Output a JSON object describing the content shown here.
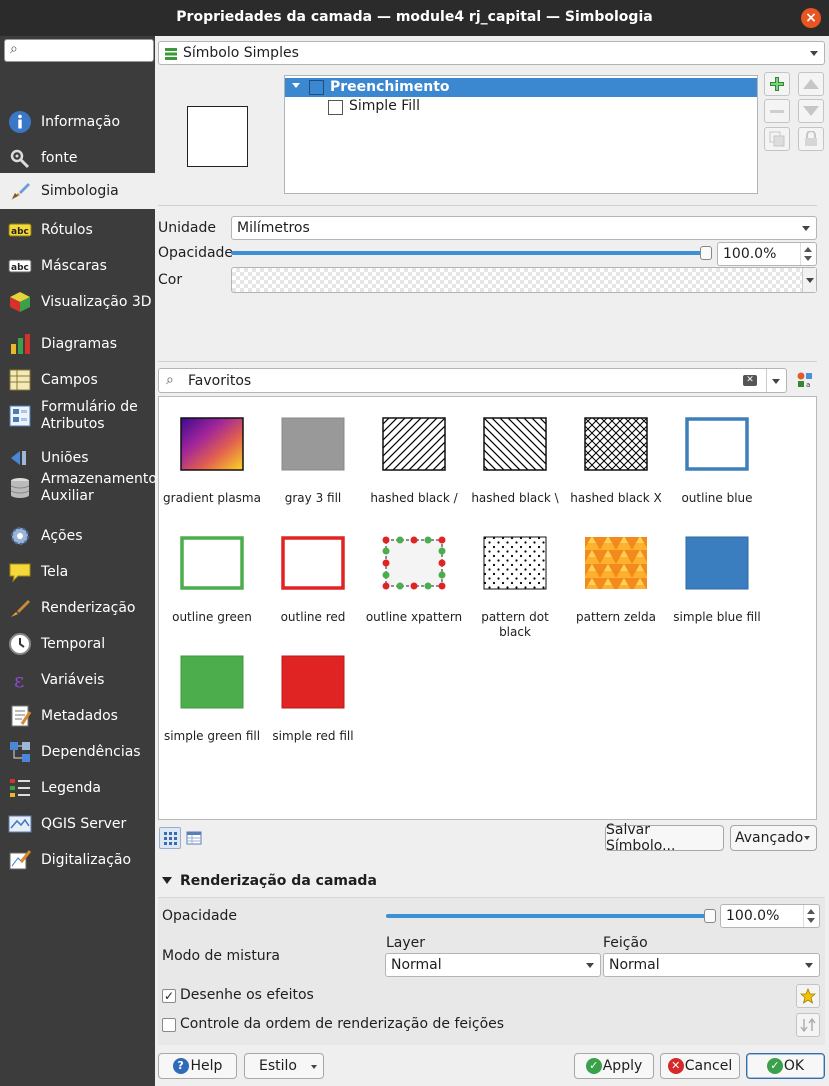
{
  "window": {
    "title": "Propriedades da camada — module4 rj_capital — Simbologia"
  },
  "sidebar": {
    "search_placeholder": "",
    "items": [
      {
        "label": "Informação",
        "icon": "info-icon"
      },
      {
        "label": "fonte",
        "icon": "source-settings-icon"
      },
      {
        "label": "Simbologia",
        "icon": "symbology-brush-icon",
        "active": true
      },
      {
        "label": "Rótulos",
        "icon": "labels-abc-icon"
      },
      {
        "label": "Máscaras",
        "icon": "masks-abc-icon"
      },
      {
        "label": "Visualização 3D",
        "icon": "3d-cube-icon"
      },
      {
        "label": "Diagramas",
        "icon": "diagram-icon"
      },
      {
        "label": "Campos",
        "icon": "fields-icon"
      },
      {
        "label": "Formulário de Atributos",
        "icon": "attribute-form-icon"
      },
      {
        "label": "Uniões",
        "icon": "joins-icon"
      },
      {
        "label": "Armazenamento Auxiliar",
        "icon": "auxiliary-storage-icon"
      },
      {
        "label": "Ações",
        "icon": "actions-gear-icon"
      },
      {
        "label": "Tela",
        "icon": "display-speech-icon"
      },
      {
        "label": "Renderização",
        "icon": "rendering-brush-icon"
      },
      {
        "label": "Temporal",
        "icon": "temporal-clock-icon"
      },
      {
        "label": "Variáveis",
        "icon": "variables-epsilon-icon"
      },
      {
        "label": "Metadados",
        "icon": "metadata-icon"
      },
      {
        "label": "Dependências",
        "icon": "dependencies-icon"
      },
      {
        "label": "Legenda",
        "icon": "legend-icon"
      },
      {
        "label": "QGIS Server",
        "icon": "qgis-server-icon"
      },
      {
        "label": "Digitalização",
        "icon": "digitizing-icon"
      }
    ]
  },
  "renderer": {
    "type_label": "Símbolo Simples"
  },
  "symbol_tree": {
    "root_label": "Preenchimento",
    "child_label": "Simple Fill"
  },
  "properties": {
    "unit_label": "Unidade",
    "unit_value": "Milímetros",
    "opacity_label": "Opacidade",
    "opacity_value": "100.0%",
    "opacity_fraction": 1.0,
    "color_label": "Cor"
  },
  "library": {
    "search_value": "Favoritos",
    "symbols": [
      {
        "name": "gradient plasma"
      },
      {
        "name": "gray 3 fill"
      },
      {
        "name": "hashed black /"
      },
      {
        "name": "hashed black \\"
      },
      {
        "name": "hashed black X"
      },
      {
        "name": "outline blue"
      },
      {
        "name": "outline green"
      },
      {
        "name": "outline red"
      },
      {
        "name": "outline xpattern"
      },
      {
        "name": "pattern dot black"
      },
      {
        "name": "pattern zelda"
      },
      {
        "name": "simple blue fill"
      },
      {
        "name": "simple green fill"
      },
      {
        "name": "simple red fill"
      }
    ],
    "save_symbol_label": "Salvar Símbolo...",
    "advanced_label": "Avançado"
  },
  "layer_rendering": {
    "section_title": "Renderização da camada",
    "opacity_label": "Opacidade",
    "opacity_value": "100.0%",
    "opacity_fraction": 1.0,
    "blend_label": "Modo de mistura",
    "layer_col_label": "Layer",
    "feature_col_label": "Feição",
    "layer_blend_value": "Normal",
    "feature_blend_value": "Normal",
    "draw_effects_label": "Desenhe os efeitos",
    "draw_effects_checked": true,
    "render_order_label": "Controle da ordem de renderização de feições",
    "render_order_checked": false
  },
  "footer": {
    "help_label": "Help",
    "style_label": "Estilo",
    "apply_label": "Apply",
    "cancel_label": "Cancel",
    "ok_label": "OK"
  }
}
